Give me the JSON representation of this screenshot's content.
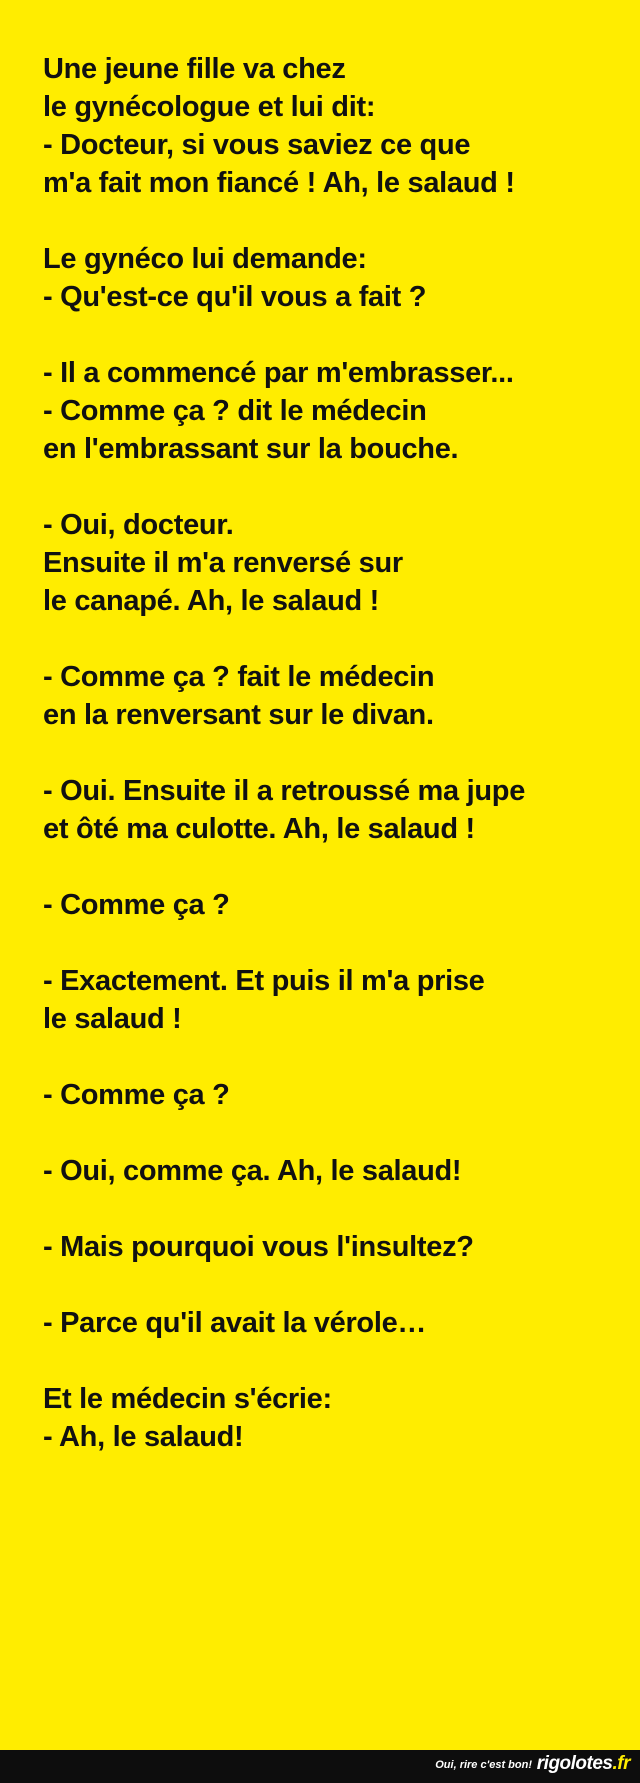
{
  "colors": {
    "background": "#FFED00",
    "text": "#111111",
    "footer_background": "#0d0d0d",
    "footer_accent": "#FFED00"
  },
  "joke": {
    "lines": [
      "Une jeune fille va chez",
      "le gynécologue et lui dit:",
      "- Docteur, si vous saviez ce que",
      "m'a fait mon fiancé ! Ah, le salaud !",
      "",
      "Le gynéco lui demande:",
      "- Qu'est-ce qu'il vous a fait ?",
      "",
      "- Il a commencé par m'embrasser...",
      "- Comme ça ? dit le médecin",
      "en l'embrassant sur la bouche.",
      "",
      "- Oui, docteur.",
      "Ensuite il m'a renversé sur",
      "le canapé. Ah, le salaud !",
      "",
      "- Comme ça ? fait le médecin",
      "en la renversant sur le divan.",
      "",
      "- Oui. Ensuite il a retroussé ma jupe",
      "et ôté ma culotte. Ah, le salaud !",
      "",
      "- Comme ça ?",
      "",
      "- Exactement. Et puis il m'a prise",
      "le salaud !",
      "",
      "- Comme ça ?",
      "",
      "- Oui, comme ça. Ah, le salaud!",
      "",
      "- Mais pourquoi vous l'insultez?",
      "",
      "- Parce qu'il avait la vérole…",
      "",
      "Et le médecin s'écrie:",
      "- Ah, le salaud!"
    ]
  },
  "footer": {
    "tagline": "Oui, rire c'est bon!",
    "logo_name": "rigolotes",
    "logo_tld": ".fr"
  }
}
